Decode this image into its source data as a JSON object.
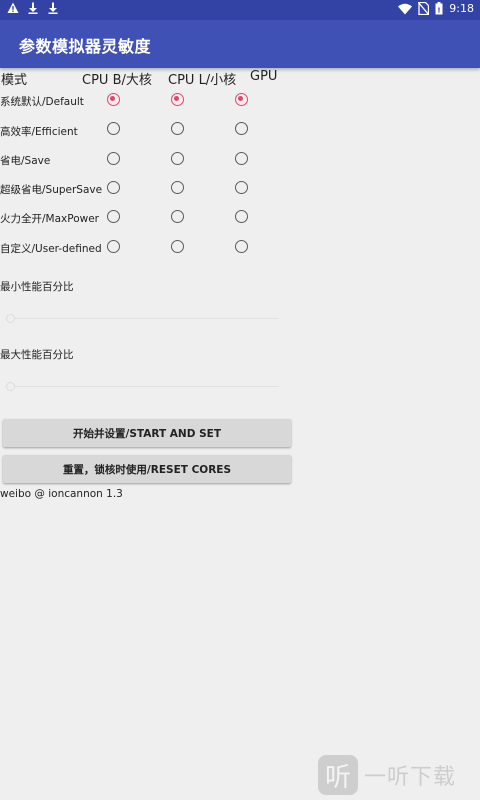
{
  "status_bar": {
    "time": "9:18",
    "left_icons": [
      "warning-icon",
      "download-icon",
      "download-icon"
    ],
    "right_icons": [
      "wifi-icon",
      "no-sim-icon",
      "battery-icon"
    ]
  },
  "app": {
    "title": "参数模拟器灵敏度"
  },
  "table": {
    "headers": {
      "mode": "模式",
      "cpu_big": "CPU B/大核",
      "cpu_little": "CPU L/小核",
      "gpu": "GPU"
    },
    "rows": [
      {
        "label": "系统默认/Default",
        "cpu_big": true,
        "cpu_little": true,
        "gpu": true
      },
      {
        "label": "高效率/Efficient",
        "cpu_big": false,
        "cpu_little": false,
        "gpu": false
      },
      {
        "label": "省电/Save",
        "cpu_big": false,
        "cpu_little": false,
        "gpu": false
      },
      {
        "label": "超级省电/SuperSave",
        "cpu_big": false,
        "cpu_little": false,
        "gpu": false
      },
      {
        "label": "火力全开/MaxPower",
        "cpu_big": false,
        "cpu_little": false,
        "gpu": false
      },
      {
        "label": "自定义/User-defined",
        "cpu_big": false,
        "cpu_little": false,
        "gpu": false
      }
    ]
  },
  "min_perf": {
    "label": "最小性能百分比",
    "value_fraction": 0
  },
  "max_perf": {
    "label": "最大性能百分比",
    "value_fraction": 0
  },
  "buttons": {
    "start": "开始并设置/START AND SET",
    "reset": "重置，锁核时使用/RESET CORES"
  },
  "footer": "weibo @ ioncannon 1.3",
  "watermark": {
    "glyph": "听",
    "text": "一听下载"
  },
  "colors": {
    "primary": "#3f51b5",
    "status_bar": "#3343a5",
    "accent": "#e2466f"
  }
}
